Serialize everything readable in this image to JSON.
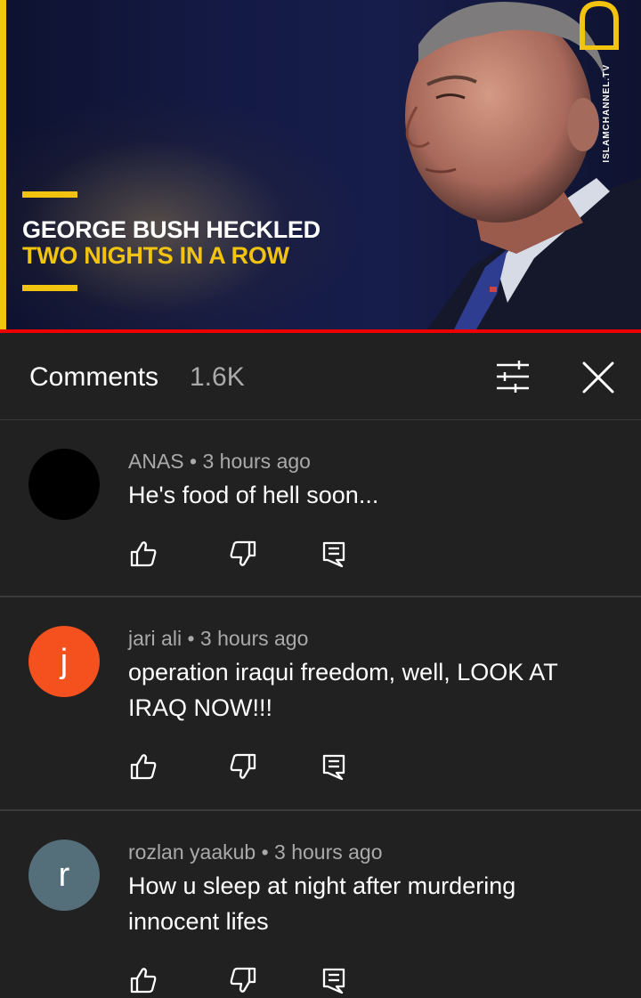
{
  "video": {
    "headline_line1": "GEORGE BUSH HECKLED",
    "headline_line2": "TWO NIGHTS IN A ROW",
    "watermark": "ISLAMCHANNEL.TV",
    "accent_color": "#f2c40f",
    "progress_color": "#ee0000"
  },
  "comments_panel": {
    "title": "Comments",
    "count": "1.6K",
    "filter_icon": "sort-sliders-icon",
    "close_icon": "close-icon"
  },
  "comments": [
    {
      "author": "ANAS",
      "time": "3 hours ago",
      "meta": "ANAS • 3 hours ago",
      "text": "He's food of hell soon...",
      "avatar_letter": "",
      "avatar_color": "#000000"
    },
    {
      "author": "jari ali",
      "time": "3 hours ago",
      "meta": "jari ali • 3 hours ago",
      "text": "operation iraqui freedom, well, LOOK AT IRAQ NOW!!!",
      "avatar_letter": "j",
      "avatar_color": "#f4511e"
    },
    {
      "author": "rozlan yaakub",
      "time": "3 hours ago",
      "meta": "rozlan yaakub • 3 hours ago",
      "text": "How u sleep at night after murdering innocent lifes",
      "avatar_letter": "r",
      "avatar_color": "#546e7a"
    }
  ],
  "action_icons": [
    "thumbs-up-icon",
    "thumbs-down-icon",
    "reply-icon"
  ]
}
